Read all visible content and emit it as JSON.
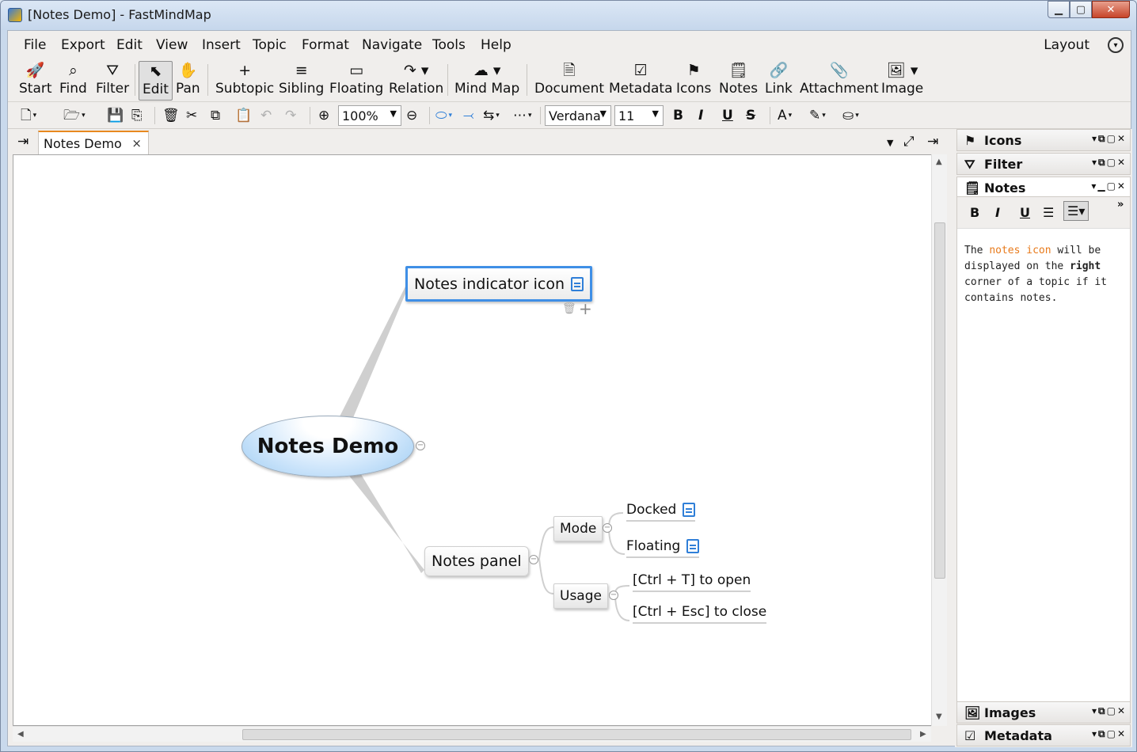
{
  "window": {
    "title": "[Notes Demo] - FastMindMap"
  },
  "menu": {
    "items": [
      "File",
      "Export",
      "Edit",
      "View",
      "Insert",
      "Topic",
      "Format",
      "Navigate",
      "Tools",
      "Help"
    ],
    "layout_label": "Layout"
  },
  "toolbar": {
    "buttons": [
      "Start",
      "Find",
      "Filter",
      "Edit",
      "Pan",
      "Subtopic",
      "Sibling",
      "Floating",
      "Relation",
      "Mind Map",
      "Document",
      "Metadata",
      "Icons",
      "Notes",
      "Link",
      "Attachment",
      "Image"
    ],
    "active_button": "Edit"
  },
  "format_bar": {
    "zoom": "100%",
    "font_name": "Verdana",
    "font_size": "11",
    "bold": "B",
    "italic": "I",
    "underline": "U",
    "strike": "S",
    "font_color": "A"
  },
  "tabs": [
    {
      "label": "Notes Demo",
      "close": "×"
    }
  ],
  "mindmap": {
    "central": "Notes Demo",
    "topics": [
      {
        "label": "Notes indicator icon",
        "has_note": true,
        "selected": true
      },
      {
        "label": "Notes panel",
        "has_note": false
      }
    ],
    "subtopics": [
      {
        "label": "Mode",
        "children": [
          {
            "label": "Docked",
            "has_note": true
          },
          {
            "label": "Floating",
            "has_note": true
          }
        ]
      },
      {
        "label": "Usage",
        "children": [
          {
            "label": "[Ctrl + T] to open"
          },
          {
            "label": "[Ctrl + Esc] to close"
          }
        ]
      }
    ]
  },
  "panels": {
    "icons": "Icons",
    "filter": "Filter",
    "notes": "Notes",
    "images": "Images",
    "metadata": "Metadata"
  },
  "notes_editor": {
    "tools": [
      "B",
      "I",
      "U"
    ],
    "text_parts": [
      "The ",
      "notes icon",
      " will be displayed on the ",
      "right",
      " corner of a topic if it contains notes."
    ]
  },
  "colors": {
    "accent": "#e8891f",
    "selection": "#3f8fe6",
    "note_icon": "#2f7fd8",
    "highlight_text": "#e87a1b"
  }
}
